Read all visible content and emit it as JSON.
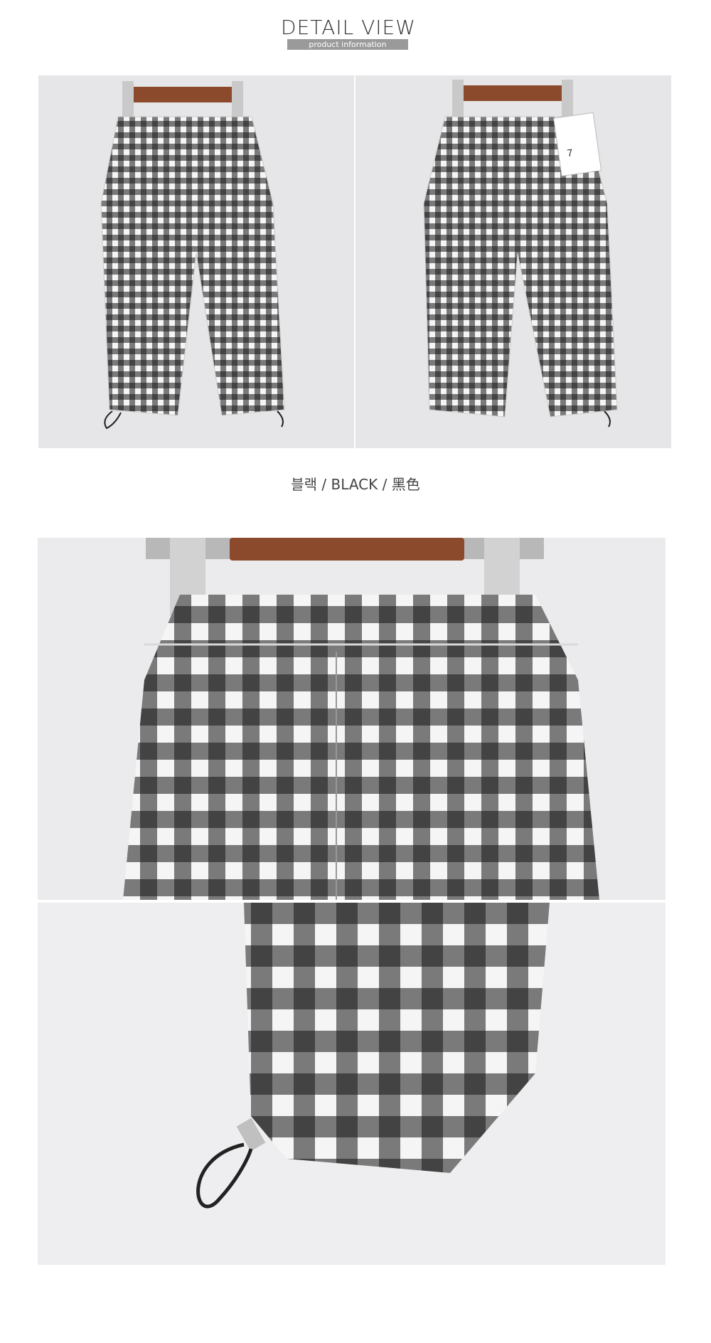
{
  "section": {
    "title": "DETAIL VIEW",
    "subtitle": "product information"
  },
  "photos": {
    "front": "front-view-photo",
    "back": "back-view-photo",
    "waist": "waist-closeup-photo",
    "hem": "hem-closeup-photo"
  },
  "back_tag": {
    "size": "7"
  },
  "color_caption": "블랙 / BLACK / 黑色",
  "colors": {
    "subtitle_bar": "#9a9a9a",
    "photo_background": "#e6e5e7",
    "hanger_wood": "#8b4a2b",
    "check_dark": "#151515",
    "check_light": "#f5f5f5"
  }
}
